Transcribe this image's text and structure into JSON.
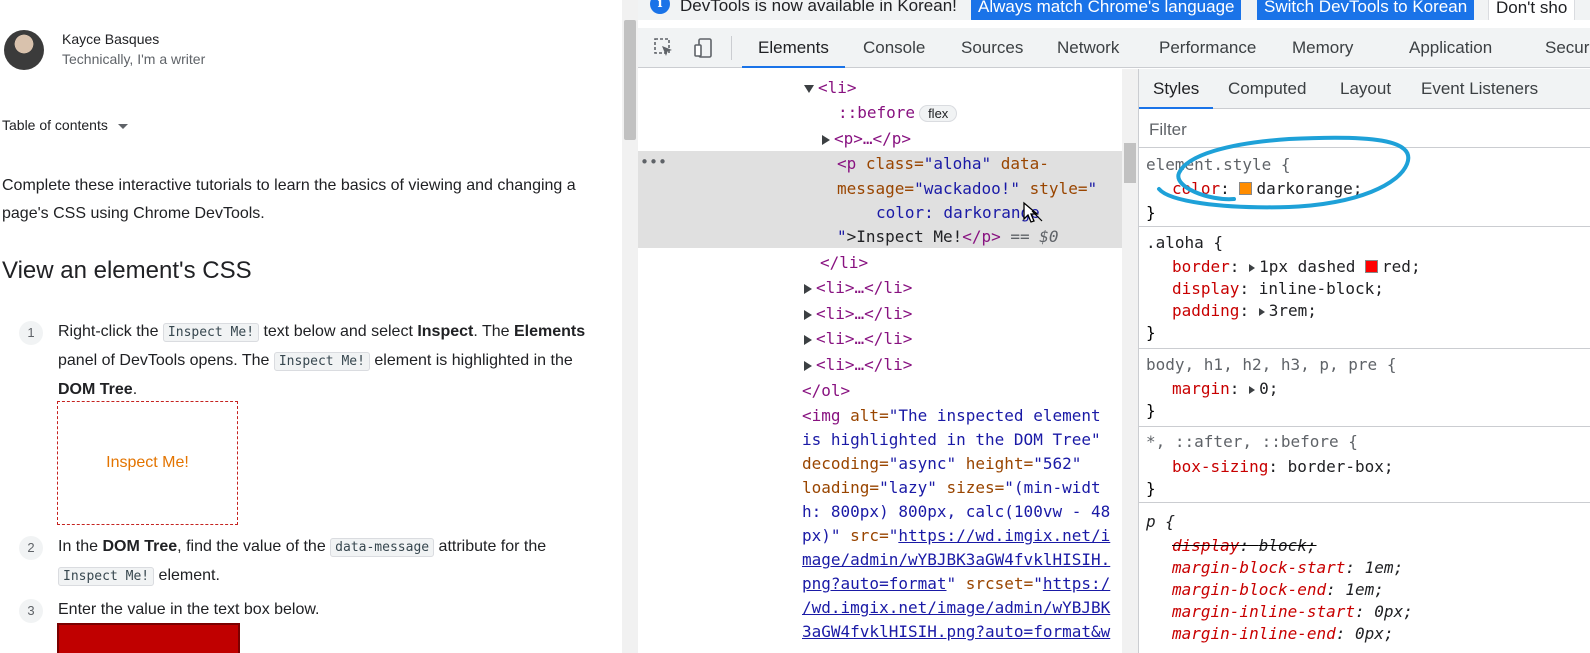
{
  "doc": {
    "author_name": "Kayce Basques",
    "author_tagline": "Technically, I'm a writer",
    "toc_label": "Table of contents",
    "intro": "Complete these interactive tutorials to learn the basics of viewing and changing a page's CSS using Chrome DevTools.",
    "section_heading": "View an element's CSS",
    "steps": [
      {
        "num": "1",
        "a": "Right-click the ",
        "code1": "Inspect Me!",
        "b": " text below and select ",
        "bold1": "Inspect",
        "c": ". The ",
        "bold2": "Elements",
        "d": " panel of DevTools opens. The ",
        "code2": "Inspect Me!",
        "e": " element is highlighted in the ",
        "bold3": "DOM Tree",
        "f": "."
      },
      {
        "num": "2",
        "a": "In the ",
        "bold1": "DOM Tree",
        "b": ", find the value of the ",
        "code1": "data-message",
        "c": " attribute for the ",
        "code2": "Inspect Me!",
        "d": " element."
      },
      {
        "num": "3",
        "a": "Enter the value in the text box below."
      }
    ],
    "inspect_box_text": "Inspect Me!"
  },
  "devtools": {
    "infobar": {
      "icon": "i",
      "message": "DevTools is now available in Korean!",
      "btn_match": "Always match Chrome's language",
      "btn_switch": "Switch DevTools to Korean",
      "btn_dont": "Don't sho"
    },
    "tabs": [
      "Elements",
      "Console",
      "Sources",
      "Network",
      "Performance",
      "Memory",
      "Application",
      "Securit"
    ],
    "active_tab": "Elements",
    "style_tabs": [
      "Styles",
      "Computed",
      "Layout",
      "Event Listeners"
    ],
    "filter_placeholder": "Filter",
    "dom": {
      "li_open": "<li>",
      "before": "::before",
      "flex_badge": "flex",
      "p_collapsed": "<p>…</p>",
      "sel_p_tag": "<p",
      "sel_attr_class": " class=",
      "sel_val_class": "\"aloha\"",
      "sel_attr_data": " data-",
      "sel_attr_data2": "message=",
      "sel_val_data": "\"wackadoo!\"",
      "sel_attr_style": " style=",
      "sel_val_style_open": "\"",
      "sel_style_line": "color: darkorange",
      "sel_val_style_close": "\"",
      "sel_text": ">Inspect Me!",
      "sel_close": "</p>",
      "sel_eq": " == $0",
      "li_close": "</li>",
      "li_collapsed": "<li>…</li>",
      "ol_close": "</ol>",
      "img_lines": [
        [
          "<img",
          " alt=",
          "\"The inspected element"
        ],
        [
          "is highlighted in the DOM Tree\""
        ],
        [
          "decoding=",
          "\"async\"",
          " height=",
          "\"562\""
        ],
        [
          "loading=",
          "\"lazy\"",
          " sizes=",
          "\"(min-widt"
        ],
        [
          "h: 800px) 800px, calc(100vw - 48"
        ],
        [
          "px)\"",
          " src=",
          "\"",
          "https://wd.imgix.net/i"
        ],
        [
          "mage/admin/wYBJBK3aGW4fvklHISIH."
        ],
        [
          "png?auto=format",
          "\"",
          " srcset=",
          "\"",
          "https:/"
        ],
        [
          "/wd.imgix.net/image/admin/wYBJBK"
        ],
        [
          "3aGW4fvklHISIH.png?auto=format&w"
        ]
      ]
    },
    "styles": {
      "element_style": {
        "selector": "element.style {",
        "prop": "color",
        "value": "darkorange",
        "swatch": "#ff8c00"
      },
      "aloha": {
        "selector": ".aloha {",
        "border_prop": "border",
        "border_val": "1px dashed",
        "border_color": "red",
        "border_swatch": "#ff0000",
        "display_prop": "display",
        "display_val": "inline-block",
        "padding_prop": "padding",
        "padding_val": "3rem"
      },
      "body_rule": {
        "selector": "body, h1, h2, h3, p, pre {",
        "prop": "margin",
        "value": "0"
      },
      "universal": {
        "selector": "*, ::after, ::before {",
        "prop": "box-sizing",
        "value": "border-box"
      },
      "p_rule": {
        "selector": "p {",
        "props": [
          {
            "name": "display",
            "value": "block",
            "struck": true
          },
          {
            "name": "margin-block-start",
            "value": "1em",
            "struck": false
          },
          {
            "name": "margin-block-end",
            "value": "1em",
            "struck": false
          },
          {
            "name": "margin-inline-start",
            "value": "0px",
            "struck": false
          },
          {
            "name": "margin-inline-end",
            "value": "0px",
            "struck": false
          }
        ]
      },
      "close": "}"
    },
    "annotation_color": "#1ea1d8"
  }
}
